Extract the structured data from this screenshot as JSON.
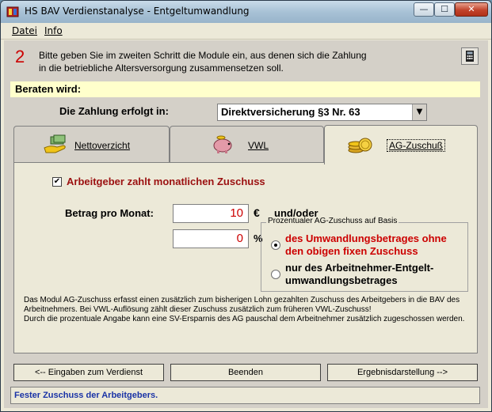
{
  "window": {
    "title": "HS BAV Verdienstanalyse -  Entgeltumwandlung",
    "min_glyph": "—",
    "max_glyph": "☐",
    "close_glyph": "✕"
  },
  "menu": {
    "datei": "Datei",
    "info": "Info"
  },
  "intro": {
    "step": "2",
    "text": "Bitte geben Sie im zweiten Schritt die Module ein, aus denen sich die Zahlung in die betriebliche Altersversorgung zusammensetzen soll."
  },
  "beraten_label": "Beraten wird:",
  "zahlung": {
    "label": "Die Zahlung erfolgt in:",
    "selected": "Direktversicherung §3 Nr. 63"
  },
  "tabs": {
    "netto": "Nettoverzicht",
    "vwl": "VWL",
    "ag": "AG-Zuschuß"
  },
  "ag_panel": {
    "checkbox_label": "Arbeitgeber zahlt monatlichen Zuschuss",
    "checkbox_checked": true,
    "betrag_label": "Betrag pro Monat:",
    "betrag_value": "10",
    "euro_sign": "€",
    "und_oder": "und/oder",
    "prozent_value": "0",
    "percent_sign": "%",
    "group_caption": "Prozentualer AG-Zuschuss auf Basis",
    "radio1_label": "des Umwandlungsbetrages ohne den obigen fixen Zuschuss",
    "radio2_label": "nur des Arbeitnehmer-Entgelt-umwandlungsbetrages",
    "info_line1": "Das Modul AG-Zuschuss erfasst einen zusätzlich zum bisherigen Lohn gezahlten Zuschuss des Arbeitgebers in die BAV des Arbeitnehmers. Bei VWL-Auflösung zählt dieser Zuschuss zusätzlich zum früheren VWL-Zuschuss!",
    "info_line2": "Durch die prozentuale Angabe kann eine SV-Ersparnis des AG pauschal dem Arbeitnehmer zusätzlich zugeschossen werden."
  },
  "buttons": {
    "back": "<-- Eingaben zum Verdienst",
    "end": "Beenden",
    "result": "Ergebnisdarstellung -->"
  },
  "status": "Fester Zuschuss der Arbeitgebers.",
  "colors": {
    "accent_red": "#cc0000",
    "label_red": "#9b1010",
    "status_blue": "#1a33a6",
    "highlight_yellow": "#ffffcc"
  },
  "icons": {
    "app": "app-icon",
    "calculator": "calculator-icon",
    "netto_tab": "money-hand-icon",
    "vwl_tab": "piggy-bank-icon",
    "ag_tab": "coins-icon"
  }
}
